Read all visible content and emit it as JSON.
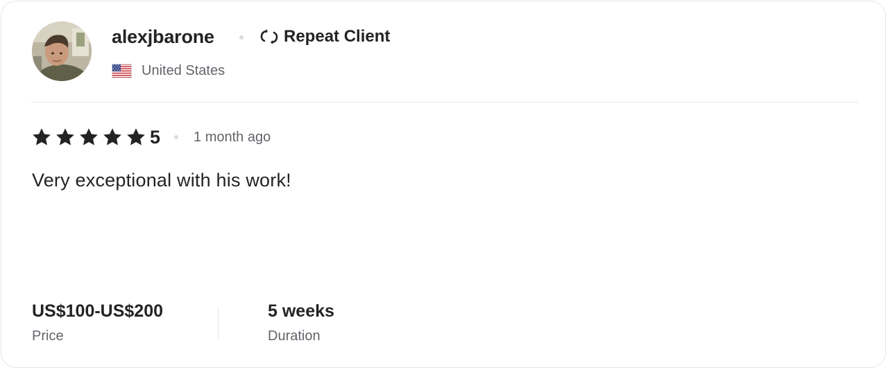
{
  "reviewer": {
    "username": "alexjbarone",
    "badge_label": "Repeat Client",
    "badge_icon": "repeat-icon",
    "country": "United States",
    "flag": "us-flag-icon"
  },
  "review": {
    "rating": "5",
    "rating_out_of": 5,
    "stars_filled": 5,
    "time_ago": "1 month ago",
    "text": "Very exceptional with his work!"
  },
  "stats": {
    "price_value": "US$100-US$200",
    "price_label": "Price",
    "duration_value": "5 weeks",
    "duration_label": "Duration"
  },
  "colors": {
    "text_primary": "#222325",
    "text_secondary": "#62646a",
    "divider": "#e4e5e7",
    "dot": "#dadbdd"
  }
}
